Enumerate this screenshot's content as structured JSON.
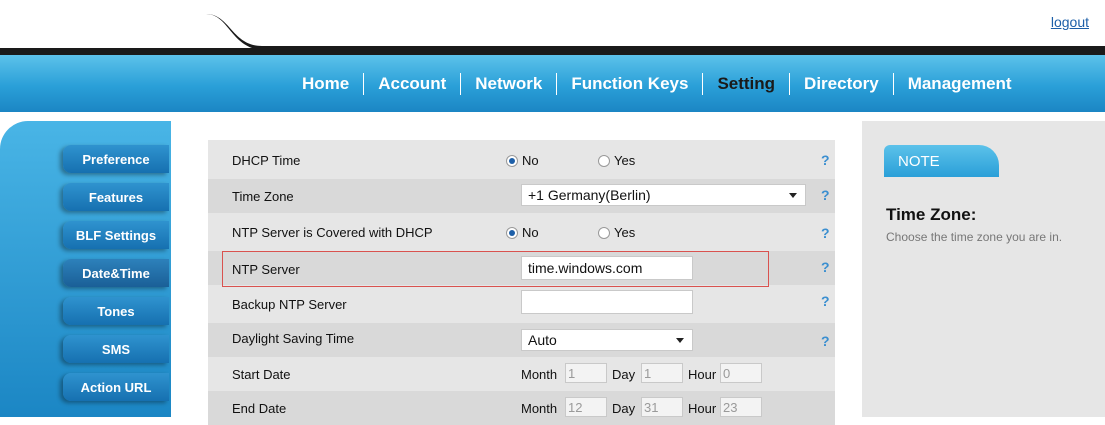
{
  "header": {
    "logout_label": "logout"
  },
  "nav": {
    "items": [
      "Home",
      "Account",
      "Network",
      "Function Keys",
      "Setting",
      "Directory",
      "Management"
    ],
    "active": "Setting"
  },
  "sidebar": {
    "items": [
      "Preference",
      "Features",
      "BLF Settings",
      "Date&Time",
      "Tones",
      "SMS",
      "Action URL"
    ],
    "active": "Date&Time"
  },
  "form": {
    "dhcp_time": {
      "label": "DHCP Time",
      "opt_no": "No",
      "opt_yes": "Yes",
      "selected": "No"
    },
    "time_zone": {
      "label": "Time Zone",
      "value": "+1 Germany(Berlin)"
    },
    "ntp_dhcp": {
      "label": "NTP Server is Covered with DHCP",
      "opt_no": "No",
      "opt_yes": "Yes",
      "selected": "No"
    },
    "ntp_server": {
      "label": "NTP Server",
      "value": "time.windows.com"
    },
    "backup_ntp": {
      "label": "Backup NTP Server",
      "value": ""
    },
    "dst": {
      "label": "Daylight Saving Time",
      "value": "Auto"
    },
    "start_date": {
      "label": "Start Date",
      "month_label": "Month",
      "month": "1",
      "day_label": "Day",
      "day": "1",
      "hour_label": "Hour",
      "hour": "0"
    },
    "end_date": {
      "label": "End Date",
      "month_label": "Month",
      "month": "12",
      "day_label": "Day",
      "day": "31",
      "hour_label": "Hour",
      "hour": "23"
    },
    "help_glyph": "?"
  },
  "note": {
    "tab_label": "NOTE",
    "title": "Time Zone:",
    "description": "Choose the time zone you are in."
  },
  "colors": {
    "nav_blue": "#2a9fd8",
    "highlight_red": "#d9524f"
  }
}
